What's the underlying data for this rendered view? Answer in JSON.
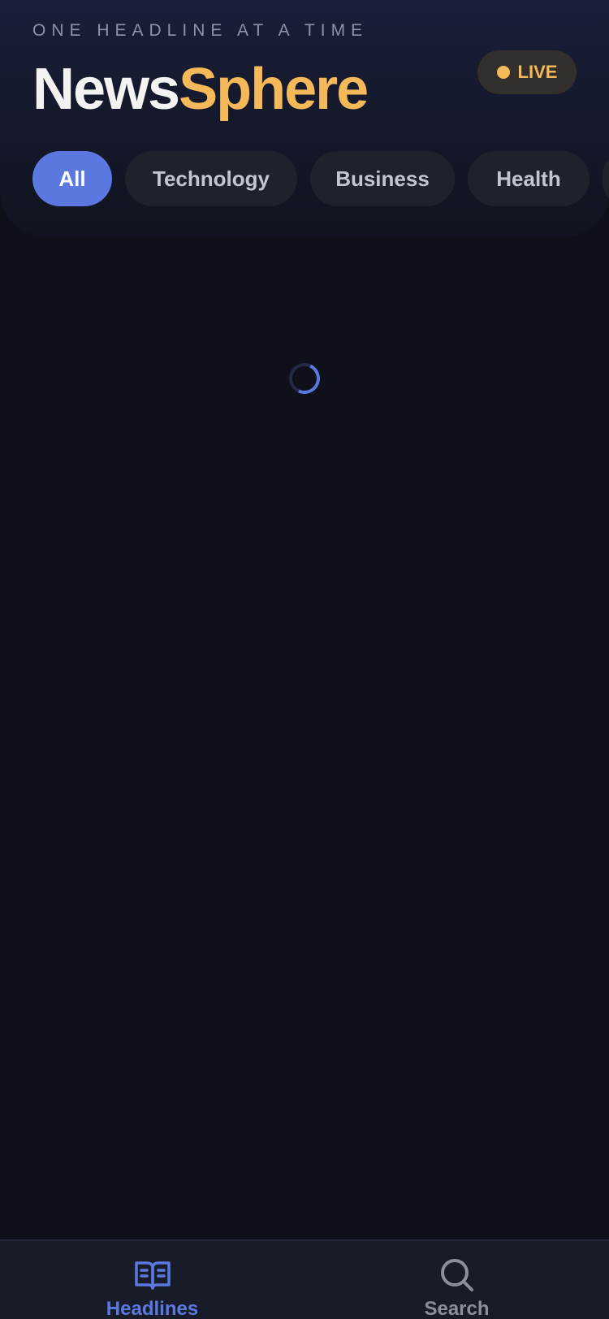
{
  "header": {
    "tagline": "ONE HEADLINE AT A TIME",
    "brand_part1": "News",
    "brand_part2": "Sphere",
    "live_label": "LIVE"
  },
  "categories": [
    {
      "label": "All",
      "active": true
    },
    {
      "label": "Technology",
      "active": false
    },
    {
      "label": "Business",
      "active": false
    },
    {
      "label": "Health",
      "active": false
    }
  ],
  "main": {
    "state": "loading"
  },
  "bottom_nav": [
    {
      "label": "Headlines",
      "icon": "open-book-icon",
      "active": true
    },
    {
      "label": "Search",
      "icon": "search-icon",
      "active": false
    }
  ],
  "colors": {
    "accent": "#5a78e0",
    "brand_highlight": "#f5b95a",
    "background": "#0e1119"
  }
}
